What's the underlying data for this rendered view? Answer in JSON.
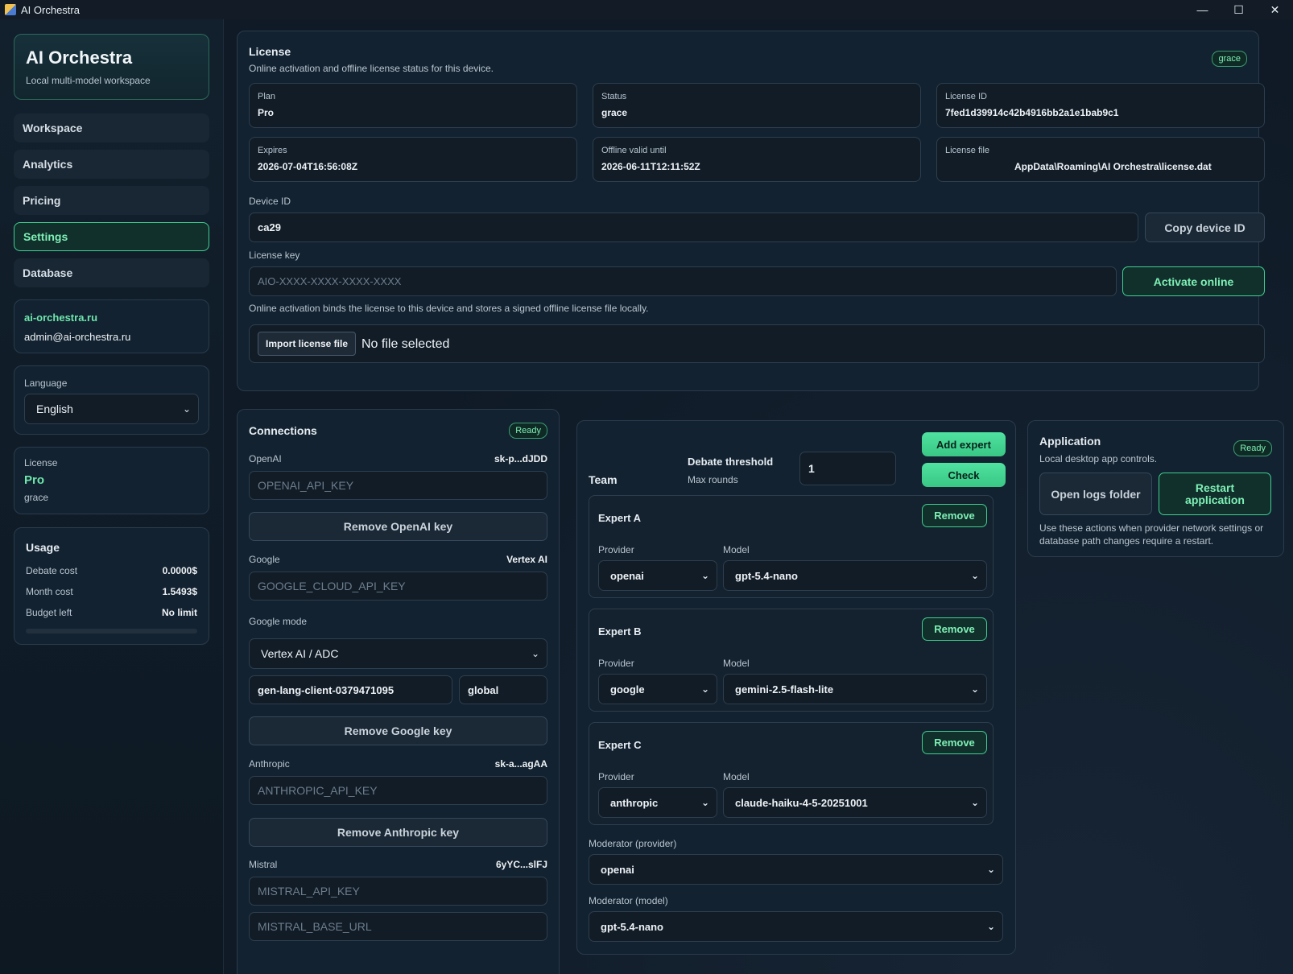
{
  "window": {
    "title": "AI Orchestra",
    "min": "—",
    "max": "☐",
    "close": "✕"
  },
  "brand": {
    "title": "AI Orchestra",
    "subtitle": "Local multi-model workspace"
  },
  "nav": [
    {
      "label": "Workspace"
    },
    {
      "label": "Analytics"
    },
    {
      "label": "Pricing"
    },
    {
      "label": "Settings"
    },
    {
      "label": "Database"
    }
  ],
  "account": {
    "site": "ai-orchestra.ru",
    "email": "admin@ai-orchestra.ru"
  },
  "language": {
    "label": "Language",
    "value": "English"
  },
  "side_license": {
    "label": "License",
    "plan": "Pro",
    "status": "grace"
  },
  "usage": {
    "title": "Usage",
    "rows": [
      {
        "k": "Debate cost",
        "v": "0.0000$"
      },
      {
        "k": "Month cost",
        "v": "1.5493$"
      },
      {
        "k": "Budget left",
        "v": "No limit"
      }
    ],
    "progress": 0
  },
  "license": {
    "title": "License",
    "subtitle": "Online activation and offline license status for this device.",
    "badge": "grace",
    "fields": [
      {
        "k": "Plan",
        "v": "Pro"
      },
      {
        "k": "Status",
        "v": "grace"
      },
      {
        "k": "License ID",
        "v": "7fed1d39914c42b4916bb2a1e1bab9c1"
      },
      {
        "k": "Expires",
        "v": "2026-07-04T16:56:08Z"
      },
      {
        "k": "Offline valid until",
        "v": "2026-06-11T12:11:52Z"
      },
      {
        "k": "License file",
        "v": "AppData\\Roaming\\AI Orchestra\\license.dat"
      }
    ],
    "device_label": "Device ID",
    "device_value": "ca29",
    "copy_btn": "Copy device ID",
    "key_label": "License key",
    "key_placeholder": "AIO-XXXX-XXXX-XXXX-XXXX",
    "activate_btn": "Activate online",
    "note": "Online activation binds the license to this device and stores a signed offline license file locally.",
    "import_btn": "Import license file",
    "no_file": "No file selected"
  },
  "connections": {
    "title": "Connections",
    "badge": "Ready",
    "openai": {
      "label": "OpenAI",
      "mask": "sk-p...dJDD",
      "placeholder": "OPENAI_API_KEY",
      "remove": "Remove OpenAI key"
    },
    "google": {
      "label": "Google",
      "mask": "Vertex AI",
      "placeholder": "GOOGLE_CLOUD_API_KEY",
      "mode_label": "Google mode",
      "mode": "Vertex AI / ADC",
      "project": "gen-lang-client-0379471095",
      "region": "global",
      "remove": "Remove Google key"
    },
    "anthropic": {
      "label": "Anthropic",
      "mask": "sk-a...agAA",
      "placeholder": "ANTHROPIC_API_KEY",
      "remove": "Remove Anthropic key"
    },
    "mistral": {
      "label": "Mistral",
      "mask": "6yYC...slFJ",
      "placeholder": "MISTRAL_API_KEY",
      "base_placeholder": "MISTRAL_BASE_URL"
    }
  },
  "team": {
    "title": "Team",
    "threshold_label": "Debate threshold",
    "max_rounds": "Max rounds",
    "threshold_value": "1",
    "add_btn": "Add expert",
    "check_btn": "Check",
    "provider_label": "Provider",
    "model_label": "Model",
    "remove": "Remove",
    "experts": [
      {
        "name": "Expert A",
        "provider": "openai",
        "model": "gpt-5.4-nano"
      },
      {
        "name": "Expert B",
        "provider": "google",
        "model": "gemini-2.5-flash-lite"
      },
      {
        "name": "Expert C",
        "provider": "anthropic",
        "model": "claude-haiku-4-5-20251001"
      }
    ],
    "mod_provider_label": "Moderator (provider)",
    "mod_provider": "openai",
    "mod_model_label": "Moderator (model)",
    "mod_model": "gpt-5.4-nano"
  },
  "application": {
    "title": "Application",
    "subtitle": "Local desktop app controls.",
    "badge": "Ready",
    "logs_btn": "Open logs folder",
    "restart_btn": "Restart application",
    "note": "Use these actions when provider network settings or database path changes require a restart."
  }
}
